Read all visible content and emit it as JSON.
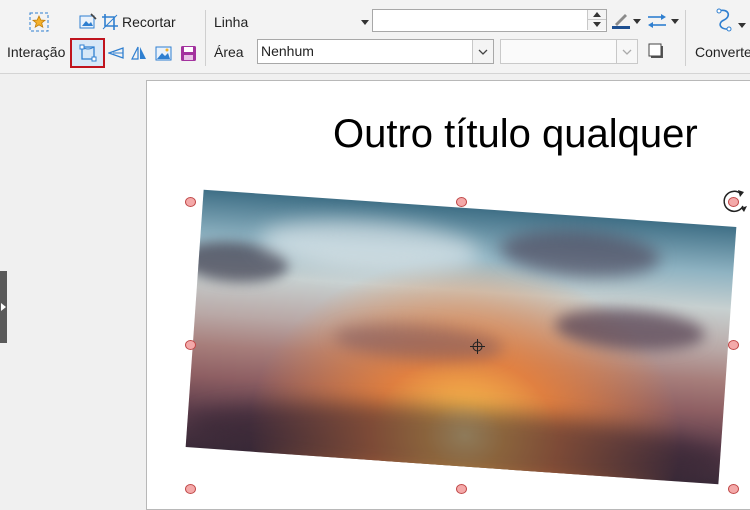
{
  "toolbar": {
    "recortar_label": "Recortar",
    "interacao_label": "Interação",
    "linha_label": "Linha",
    "area_label": "Área",
    "area_fill_value": "Nenhum",
    "line_width_value": "",
    "area_secondary_value": "",
    "converter_label": "Converter"
  },
  "slide": {
    "title": "Outro título qualquer"
  },
  "colors": {
    "selection_border": "#c0141e",
    "handle_fill": "#f4a9a9",
    "handle_border": "#c14a4a",
    "icon_accent": "#2f7fd0"
  },
  "icons": [
    "star-image-icon",
    "image-edit-icon",
    "crop-icon",
    "transformations-icon",
    "shadow-icon",
    "flip-icon",
    "replace-image-icon",
    "save-image-icon",
    "line-color-icon",
    "arrow-style-icon",
    "shadow-toggle-icon",
    "convert-icon",
    "rotate-icon",
    "center-crosshair-icon"
  ]
}
